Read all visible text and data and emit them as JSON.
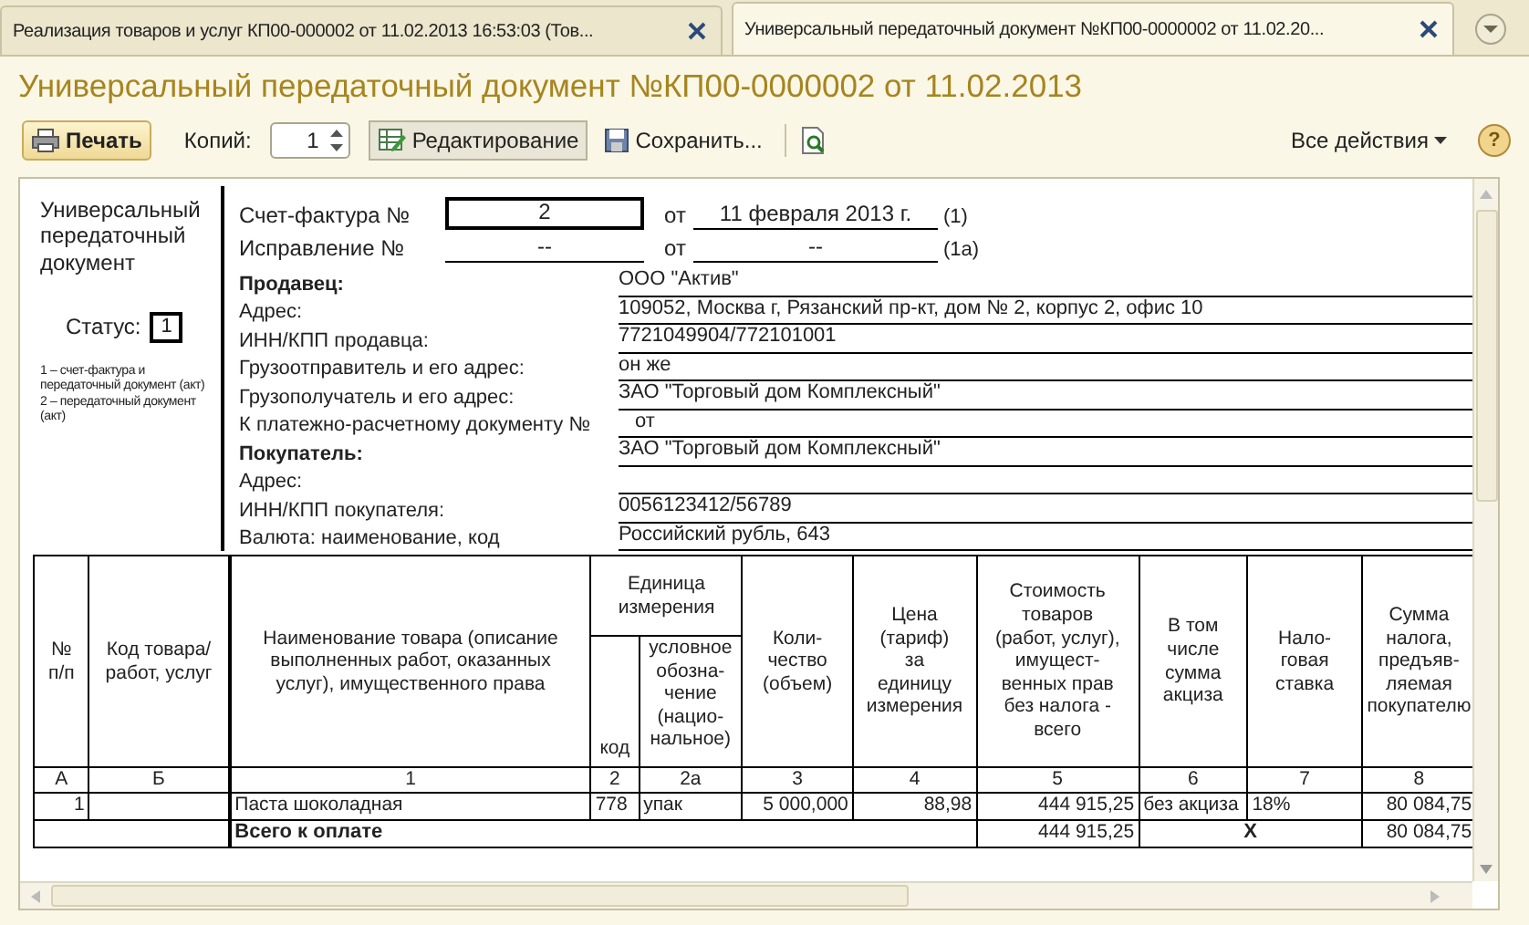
{
  "tabs": [
    {
      "label": "Реализация товаров и услуг КП00-000002 от 11.02.2013 16:53:03 (Тов...",
      "selected": false
    },
    {
      "label": "Универсальный передаточный документ №КП00-0000002 от 11.02.20...",
      "selected": true
    }
  ],
  "title": "Универсальный передаточный документ №КП00-0000002 от 11.02.2013",
  "toolbar": {
    "print": "Печать",
    "copies_label": "Копий:",
    "copies": "1",
    "edit": "Редактирование",
    "edit_pressed": true,
    "save": "Сохранить...",
    "all_actions": "Все действия",
    "help": "?"
  },
  "document": {
    "side": {
      "title": "Универсальный передаточный документ",
      "status_label": "Статус:",
      "status": "1",
      "notes": [
        "1 – счет-фактура и передаточный документ (акт)",
        "2 – передаточный документ (акт)"
      ]
    },
    "numbers": [
      {
        "label": "Счет-фактура №",
        "number": "2",
        "from": "от",
        "date": "11 февраля 2013 г.",
        "ref": "(1)",
        "boxed": true
      },
      {
        "label": "Исправление №",
        "number": "--",
        "from": "от",
        "date": "--",
        "ref": "(1а)",
        "boxed": false
      }
    ],
    "parties": [
      {
        "kind": "section",
        "label": "Продавец:",
        "value": "ООО \"Актив\""
      },
      {
        "kind": "field",
        "label": "Адрес:",
        "value": "109052, Москва г, Рязанский пр-кт, дом № 2, корпус 2, офис 10"
      },
      {
        "kind": "field",
        "label": "ИНН/КПП продавца:",
        "value": "7721049904/772101001"
      },
      {
        "kind": "field",
        "label": "Грузоотправитель и его адрес:",
        "value": "он же"
      },
      {
        "kind": "field",
        "label": "Грузополучатель и его адрес:",
        "value": "ЗАО \"Торговый дом Комплексный\""
      },
      {
        "kind": "field",
        "label": "К платежно-расчетному документу №",
        "value": "от"
      },
      {
        "kind": "section",
        "label": "Покупатель:",
        "value": "ЗАО \"Торговый дом Комплексный\""
      },
      {
        "kind": "field",
        "label": "Адрес:"
      },
      {
        "kind": "field",
        "label": "ИНН/КПП покупателя:",
        "value": "0056123412/56789"
      },
      {
        "kind": "field",
        "label": "Валюта: наименование, код",
        "value": "Российский рубль, 643"
      }
    ],
    "table": {
      "unit_group": "Единица измерения",
      "columns": [
        "№\nп/п",
        "Код товара/\nработ, услуг",
        "Наименование товара (описание\nвыполненных работ, оказанных\nуслуг), имущественного права",
        "код",
        "условное\nобозна-\nчение\n(нацио-\nнальное)",
        "Коли-\nчество\n(объем)",
        "Цена\n(тариф)\nза\nединицу\nизмерения",
        "Стоимость\nтоваров\n(работ, услуг),\nимущест-\nвенных прав\nбез налога -\nвсего",
        "В том\nчисле\nсумма\nакциза",
        "Нало-\nговая\nставка",
        "Сумма\nналога,\nпредъяв-\nляемая\nпокупателю"
      ],
      "numbering": [
        "А",
        "Б",
        "1",
        "2",
        "2а",
        "3",
        "4",
        "5",
        "6",
        "7",
        "8"
      ],
      "rows": [
        [
          "1",
          "",
          "Паста шоколадная",
          "778",
          "упак",
          "5 000,000",
          "88,98",
          "444 915,25",
          "без акциза",
          "18%",
          "80 084,75"
        ]
      ],
      "total": {
        "label": "Всего к оплате",
        "cost": "444 915,25",
        "excise": "X",
        "tax": "80 084,75"
      }
    }
  }
}
